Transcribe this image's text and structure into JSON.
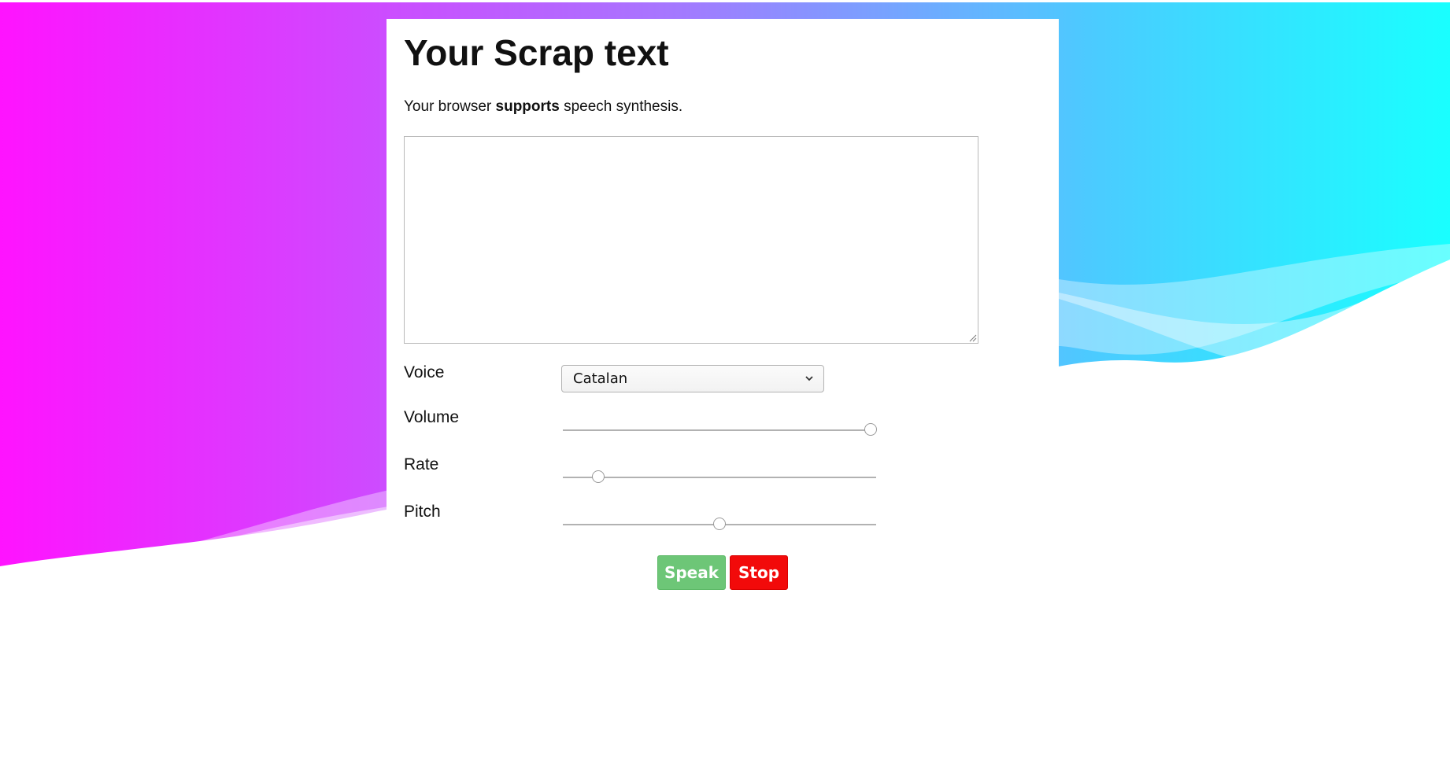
{
  "page": {
    "title": "Your Scrap text",
    "support_prefix": "Your browser ",
    "support_bold": "supports",
    "support_suffix": " speech synthesis."
  },
  "textarea": {
    "value": ""
  },
  "controls": {
    "voice_label": "Voice",
    "voice_selected": "Catalan",
    "volume_label": "Volume",
    "volume_value": 1.0,
    "rate_label": "Rate",
    "rate_value": 0.1,
    "pitch_label": "Pitch",
    "pitch_value": 0.5
  },
  "buttons": {
    "speak_label": "Speak",
    "stop_label": "Stop"
  },
  "colors": {
    "gradient_left": "#ff13ff",
    "gradient_mid": "#a974ff",
    "gradient_right": "#19ffff",
    "speak_button": "#6dc677",
    "stop_button": "#f20a0a"
  }
}
